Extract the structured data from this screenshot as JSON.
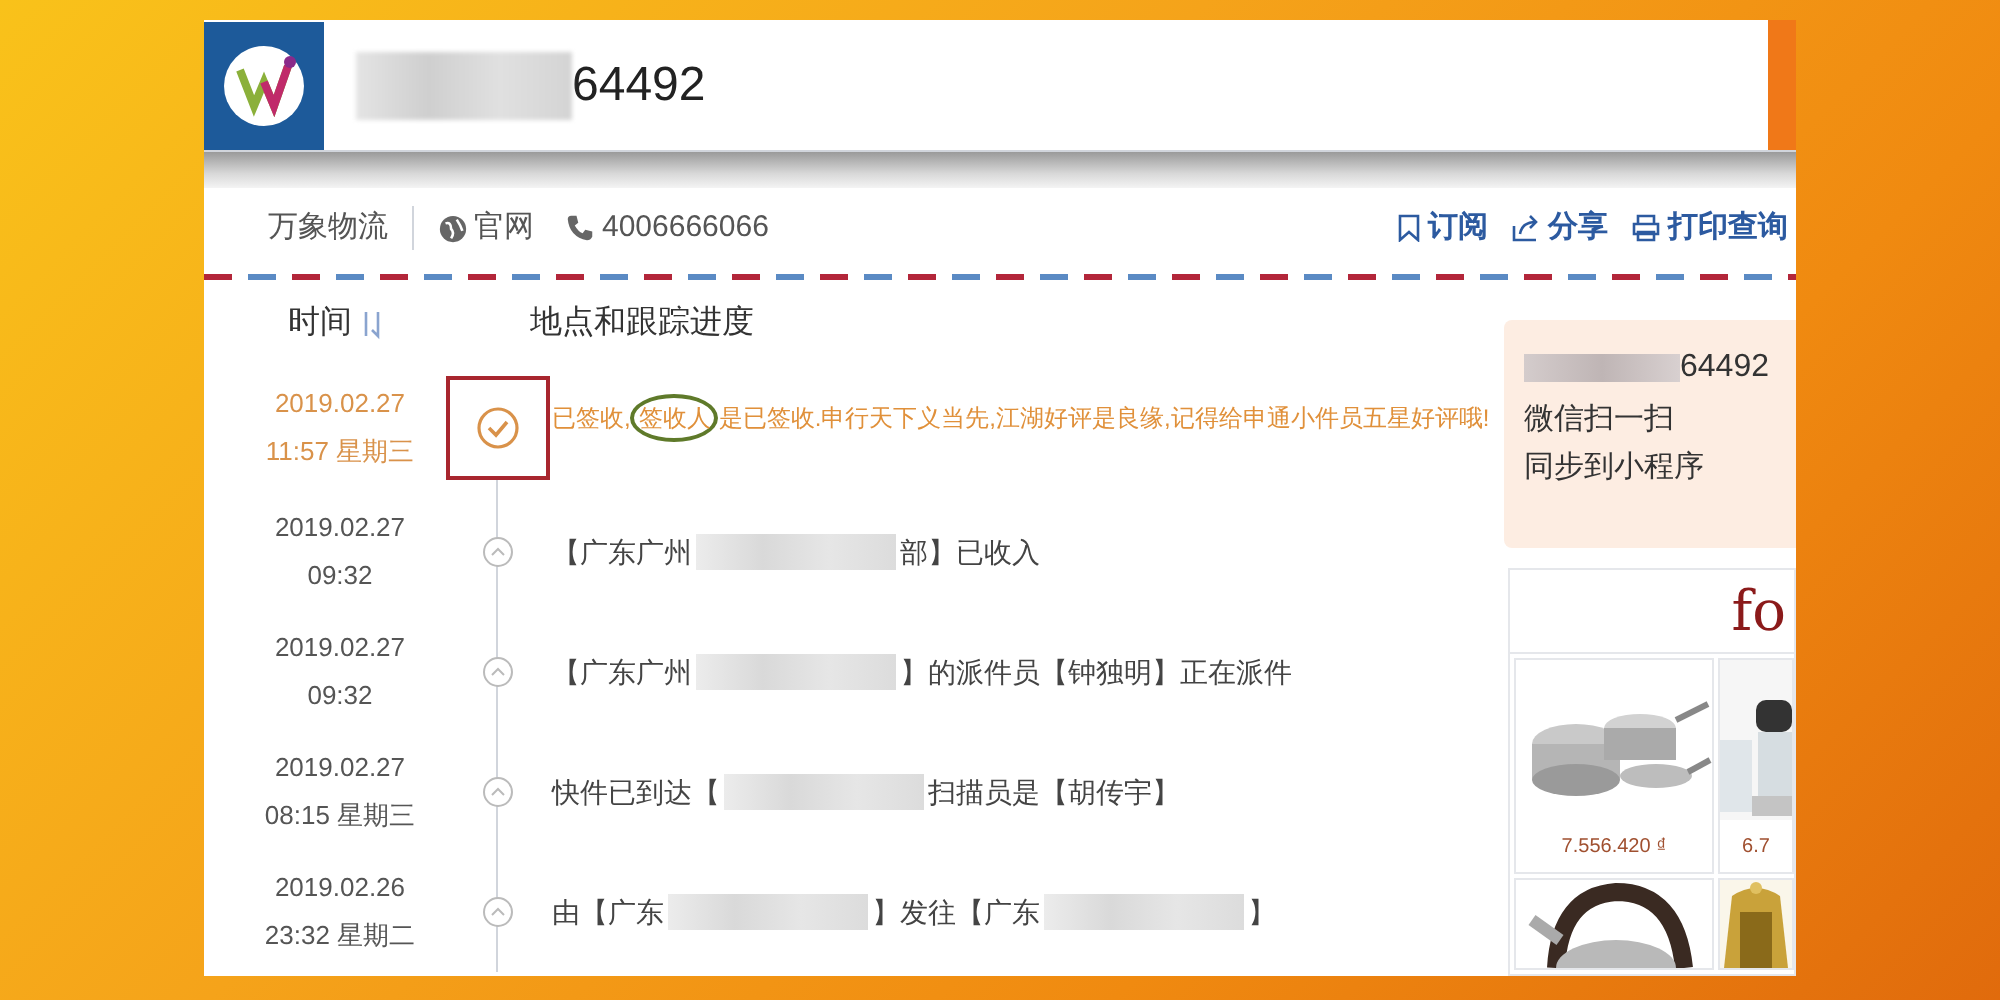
{
  "header": {
    "tracking_number_suffix": "64492"
  },
  "nav": {
    "company": "万象物流",
    "website": "官网",
    "phone": "4006666066",
    "actions": [
      {
        "label": "订阅"
      },
      {
        "label": "分享"
      },
      {
        "label": "打印查询"
      }
    ]
  },
  "timeline": {
    "time_heading": "时间",
    "progress_heading": "地点和跟踪进度",
    "events": [
      {
        "kind": "signed",
        "date": "2019.02.27",
        "time": "11:57 星期三",
        "parts": [
          {
            "text": "已签收,",
            "circled": false
          },
          {
            "text": "签收人",
            "circled": true
          },
          {
            "text": "是已签收.申行天下义当先,江湖好评是良缘,记得给申通小件员五星好评哦!",
            "circled": false
          }
        ],
        "boxed": true
      },
      {
        "kind": "normal",
        "date": "2019.02.27",
        "time": "09:32",
        "parts": [
          "【广东广州",
          "部】已收入"
        ]
      },
      {
        "kind": "normal",
        "date": "2019.02.27",
        "time": "09:32",
        "parts": [
          "【广东广州",
          "】的派件员【钟独明】正在派件"
        ]
      },
      {
        "kind": "normal",
        "date": "2019.02.27",
        "time": "08:15 星期三",
        "parts": [
          "快件已到达【",
          "扫描员是【胡传宇】"
        ]
      },
      {
        "kind": "normal",
        "date": "2019.02.26",
        "time": "23:32 星期二",
        "parts": [
          "由【广东",
          "】发往【广东",
          "】"
        ]
      }
    ]
  },
  "sidebar": {
    "tracking_number_suffix": "64492",
    "lines": [
      "微信扫一扫",
      "同步到小程序"
    ],
    "ad": {
      "logo": "fo",
      "products": [
        {
          "kind": "picture",
          "price": "7.556.420 ₫"
        },
        {
          "kind": "picture",
          "price": "6.7"
        },
        {
          "kind": "picture"
        },
        {
          "kind": "picture"
        }
      ]
    }
  }
}
